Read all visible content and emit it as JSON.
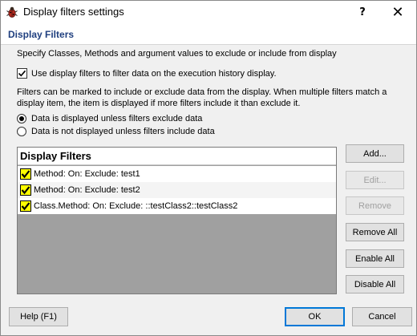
{
  "window": {
    "title": "Display filters settings",
    "help_glyph": "?",
    "close_glyph": "✕"
  },
  "header": {
    "title": "Display Filters"
  },
  "description": "Specify Classes, Methods and argument values to exclude or include from display",
  "use_filters": {
    "label": "Use display filters to filter data on the execution history display.",
    "checked": true
  },
  "filters_explanation": "Filters can be marked to include or exclude data from the display. When multiple filters match a display item, the item is displayed if more filters include it than exclude it.",
  "mode_options": [
    {
      "label": "Data is displayed unless filters exclude data",
      "selected": true
    },
    {
      "label": "Data is not displayed unless filters include data",
      "selected": false
    }
  ],
  "list": {
    "header": "Display Filters",
    "items": [
      {
        "label": "Method: On:  Exclude: test1",
        "checked": true
      },
      {
        "label": "Method: On:  Exclude: test2",
        "checked": true
      },
      {
        "label": "Class.Method: On:  Exclude: ::testClass2::testClass2",
        "checked": true
      }
    ]
  },
  "buttons": {
    "add": "Add...",
    "edit": "Edit...",
    "remove": "Remove",
    "remove_all": "Remove All",
    "enable_all": "Enable All",
    "disable_all": "Disable All",
    "help": "Help (F1)",
    "ok": "OK",
    "cancel": "Cancel"
  },
  "colors": {
    "header_text": "#1f3f7f",
    "list_empty_area": "#a0a0a0",
    "item_checkbox": "#ffff00",
    "default_button_border": "#0078d7"
  }
}
